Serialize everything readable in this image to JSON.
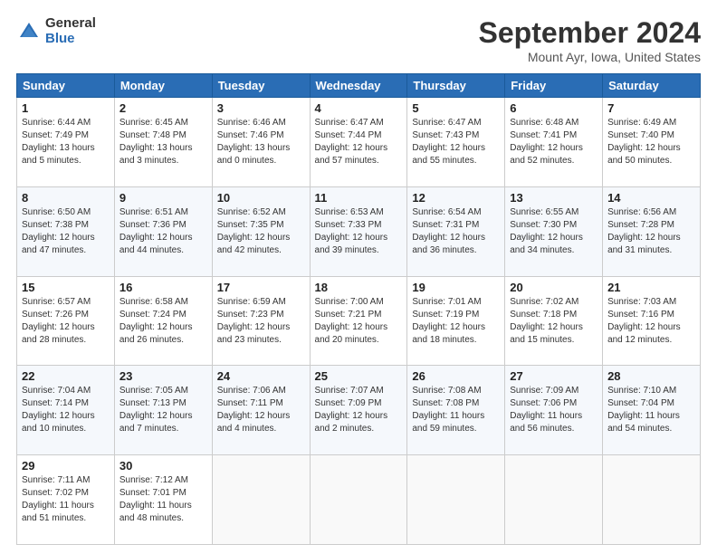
{
  "header": {
    "logo_general": "General",
    "logo_blue": "Blue",
    "main_title": "September 2024",
    "subtitle": "Mount Ayr, Iowa, United States"
  },
  "days_of_week": [
    "Sunday",
    "Monday",
    "Tuesday",
    "Wednesday",
    "Thursday",
    "Friday",
    "Saturday"
  ],
  "weeks": [
    [
      {
        "day": "1",
        "info": "Sunrise: 6:44 AM\nSunset: 7:49 PM\nDaylight: 13 hours\nand 5 minutes."
      },
      {
        "day": "2",
        "info": "Sunrise: 6:45 AM\nSunset: 7:48 PM\nDaylight: 13 hours\nand 3 minutes."
      },
      {
        "day": "3",
        "info": "Sunrise: 6:46 AM\nSunset: 7:46 PM\nDaylight: 13 hours\nand 0 minutes."
      },
      {
        "day": "4",
        "info": "Sunrise: 6:47 AM\nSunset: 7:44 PM\nDaylight: 12 hours\nand 57 minutes."
      },
      {
        "day": "5",
        "info": "Sunrise: 6:47 AM\nSunset: 7:43 PM\nDaylight: 12 hours\nand 55 minutes."
      },
      {
        "day": "6",
        "info": "Sunrise: 6:48 AM\nSunset: 7:41 PM\nDaylight: 12 hours\nand 52 minutes."
      },
      {
        "day": "7",
        "info": "Sunrise: 6:49 AM\nSunset: 7:40 PM\nDaylight: 12 hours\nand 50 minutes."
      }
    ],
    [
      {
        "day": "8",
        "info": "Sunrise: 6:50 AM\nSunset: 7:38 PM\nDaylight: 12 hours\nand 47 minutes."
      },
      {
        "day": "9",
        "info": "Sunrise: 6:51 AM\nSunset: 7:36 PM\nDaylight: 12 hours\nand 44 minutes."
      },
      {
        "day": "10",
        "info": "Sunrise: 6:52 AM\nSunset: 7:35 PM\nDaylight: 12 hours\nand 42 minutes."
      },
      {
        "day": "11",
        "info": "Sunrise: 6:53 AM\nSunset: 7:33 PM\nDaylight: 12 hours\nand 39 minutes."
      },
      {
        "day": "12",
        "info": "Sunrise: 6:54 AM\nSunset: 7:31 PM\nDaylight: 12 hours\nand 36 minutes."
      },
      {
        "day": "13",
        "info": "Sunrise: 6:55 AM\nSunset: 7:30 PM\nDaylight: 12 hours\nand 34 minutes."
      },
      {
        "day": "14",
        "info": "Sunrise: 6:56 AM\nSunset: 7:28 PM\nDaylight: 12 hours\nand 31 minutes."
      }
    ],
    [
      {
        "day": "15",
        "info": "Sunrise: 6:57 AM\nSunset: 7:26 PM\nDaylight: 12 hours\nand 28 minutes."
      },
      {
        "day": "16",
        "info": "Sunrise: 6:58 AM\nSunset: 7:24 PM\nDaylight: 12 hours\nand 26 minutes."
      },
      {
        "day": "17",
        "info": "Sunrise: 6:59 AM\nSunset: 7:23 PM\nDaylight: 12 hours\nand 23 minutes."
      },
      {
        "day": "18",
        "info": "Sunrise: 7:00 AM\nSunset: 7:21 PM\nDaylight: 12 hours\nand 20 minutes."
      },
      {
        "day": "19",
        "info": "Sunrise: 7:01 AM\nSunset: 7:19 PM\nDaylight: 12 hours\nand 18 minutes."
      },
      {
        "day": "20",
        "info": "Sunrise: 7:02 AM\nSunset: 7:18 PM\nDaylight: 12 hours\nand 15 minutes."
      },
      {
        "day": "21",
        "info": "Sunrise: 7:03 AM\nSunset: 7:16 PM\nDaylight: 12 hours\nand 12 minutes."
      }
    ],
    [
      {
        "day": "22",
        "info": "Sunrise: 7:04 AM\nSunset: 7:14 PM\nDaylight: 12 hours\nand 10 minutes."
      },
      {
        "day": "23",
        "info": "Sunrise: 7:05 AM\nSunset: 7:13 PM\nDaylight: 12 hours\nand 7 minutes."
      },
      {
        "day": "24",
        "info": "Sunrise: 7:06 AM\nSunset: 7:11 PM\nDaylight: 12 hours\nand 4 minutes."
      },
      {
        "day": "25",
        "info": "Sunrise: 7:07 AM\nSunset: 7:09 PM\nDaylight: 12 hours\nand 2 minutes."
      },
      {
        "day": "26",
        "info": "Sunrise: 7:08 AM\nSunset: 7:08 PM\nDaylight: 11 hours\nand 59 minutes."
      },
      {
        "day": "27",
        "info": "Sunrise: 7:09 AM\nSunset: 7:06 PM\nDaylight: 11 hours\nand 56 minutes."
      },
      {
        "day": "28",
        "info": "Sunrise: 7:10 AM\nSunset: 7:04 PM\nDaylight: 11 hours\nand 54 minutes."
      }
    ],
    [
      {
        "day": "29",
        "info": "Sunrise: 7:11 AM\nSunset: 7:02 PM\nDaylight: 11 hours\nand 51 minutes."
      },
      {
        "day": "30",
        "info": "Sunrise: 7:12 AM\nSunset: 7:01 PM\nDaylight: 11 hours\nand 48 minutes."
      },
      {
        "day": "",
        "info": ""
      },
      {
        "day": "",
        "info": ""
      },
      {
        "day": "",
        "info": ""
      },
      {
        "day": "",
        "info": ""
      },
      {
        "day": "",
        "info": ""
      }
    ]
  ]
}
